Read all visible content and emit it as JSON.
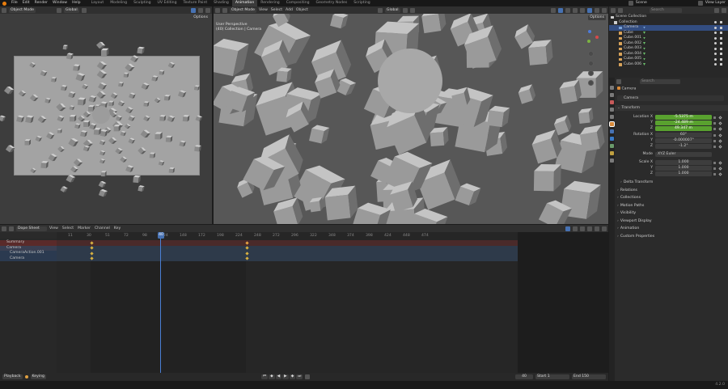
{
  "topbar": {
    "menus": [
      "File",
      "Edit",
      "Render",
      "Window",
      "Help"
    ],
    "workspaces": [
      "Layout",
      "Modeling",
      "Sculpting",
      "UV Editing",
      "Texture Paint",
      "Shading",
      "Animation",
      "Rendering",
      "Compositing",
      "Geometry Nodes",
      "Scripting"
    ],
    "active_workspace": "Animation",
    "scene": "Scene",
    "view_layer": "View Layer"
  },
  "viewport_left": {
    "mode": "Object Mode",
    "orientation": "Global",
    "options": "Options"
  },
  "viewport_right": {
    "mode": "Object Mode",
    "menus": [
      "View",
      "Select",
      "Add",
      "Object"
    ],
    "orientation": "Global",
    "options": "Options",
    "overlay_title": "User Perspective",
    "overlay_sub": "(40) Collection | Camera"
  },
  "outliner": {
    "search_placeholder": "Search",
    "rows": [
      {
        "name": "Scene Collection",
        "kind": "scene"
      },
      {
        "name": "Collection",
        "kind": "collection"
      },
      {
        "name": "Camera",
        "kind": "camera",
        "selected": true
      },
      {
        "name": "Cube",
        "kind": "mesh"
      },
      {
        "name": "Cube.001",
        "kind": "mesh"
      },
      {
        "name": "Cube.002",
        "kind": "mesh"
      },
      {
        "name": "Cube.003",
        "kind": "mesh"
      },
      {
        "name": "Cube.004",
        "kind": "mesh"
      },
      {
        "name": "Cube.005",
        "kind": "mesh"
      },
      {
        "name": "Cube.006",
        "kind": "mesh"
      }
    ]
  },
  "properties": {
    "search_placeholder": "Search",
    "object_name_top": "Camera",
    "object_name": "Camera",
    "transform_label": "Transform",
    "location_label": "Location X",
    "location": [
      "-5.5375 m",
      "-24.489 m",
      "49.347 m"
    ],
    "rotation_label": "Rotation X",
    "rotation": [
      "60°",
      "-0.000007°",
      "-1.2°"
    ],
    "mode_label": "Mode",
    "mode_value": "XYZ Euler",
    "scale_label": "Scale X",
    "scale": [
      "1.000",
      "1.000",
      "1.000"
    ],
    "axis": [
      "Y",
      "Z"
    ],
    "sections": [
      "Delta Transform",
      "Relations",
      "Collections",
      "Motion Paths",
      "Visibility",
      "Viewport Display",
      "Animation",
      "Custom Properties"
    ]
  },
  "dopesheet": {
    "mode": "Dope Sheet",
    "menus": [
      "View",
      "Select",
      "Marker",
      "Channel",
      "Key"
    ],
    "channels": [
      "Summary",
      "Camera",
      "CameraAction.001",
      "Camera"
    ],
    "frames": [
      "11",
      "30",
      "51",
      "72",
      "98",
      "124",
      "148",
      "172",
      "198",
      "224",
      "248",
      "272",
      "296",
      "322",
      "348",
      "374",
      "398",
      "424",
      "448",
      "474"
    ],
    "current_frame": "40"
  },
  "footer": {
    "playback": "Playback",
    "keying": "Keying",
    "current": "40",
    "start_label": "Start",
    "start": "1",
    "end_label": "End",
    "end": "150"
  },
  "status": {
    "version": "4.2.0"
  }
}
